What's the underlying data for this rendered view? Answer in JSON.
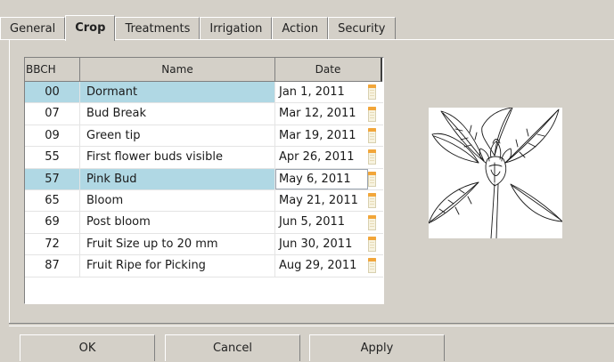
{
  "tabs": [
    {
      "label": "General"
    },
    {
      "label": "Crop"
    },
    {
      "label": "Treatments"
    },
    {
      "label": "Irrigation"
    },
    {
      "label": "Action"
    },
    {
      "label": "Security"
    }
  ],
  "active_tab": "Crop",
  "table": {
    "headers": {
      "bbch": "BBCH",
      "name": "Name",
      "date": "Date"
    },
    "rows": [
      {
        "bbch": "00",
        "name": "Dormant",
        "date": "Jan 1, 2011"
      },
      {
        "bbch": "07",
        "name": "Bud Break",
        "date": "Mar 12, 2011"
      },
      {
        "bbch": "09",
        "name": "Green tip",
        "date": "Mar 19, 2011"
      },
      {
        "bbch": "55",
        "name": "First flower buds visible",
        "date": "Apr 26, 2011"
      },
      {
        "bbch": "57",
        "name": "Pink Bud",
        "date": "May 6, 2011"
      },
      {
        "bbch": "65",
        "name": "Bloom",
        "date": "May 21, 2011"
      },
      {
        "bbch": "69",
        "name": "Post bloom",
        "date": "Jun 5, 2011"
      },
      {
        "bbch": "72",
        "name": "Fruit Size up to 20 mm",
        "date": "Jun 30, 2011"
      },
      {
        "bbch": "87",
        "name": "Fruit Ripe for Picking",
        "date": "Aug 29, 2011"
      }
    ],
    "selected_rows": [
      "00",
      "57"
    ],
    "row_icon": "calendar-icon"
  },
  "illustration": {
    "icon": "flower-bud-illustration"
  },
  "buttons": {
    "ok": "OK",
    "cancel": "Cancel",
    "apply": "Apply"
  },
  "colors": {
    "window_bg": "#d4d0c8",
    "selection": "#b0d8e4",
    "calendar_accent": "#f2a63a"
  }
}
